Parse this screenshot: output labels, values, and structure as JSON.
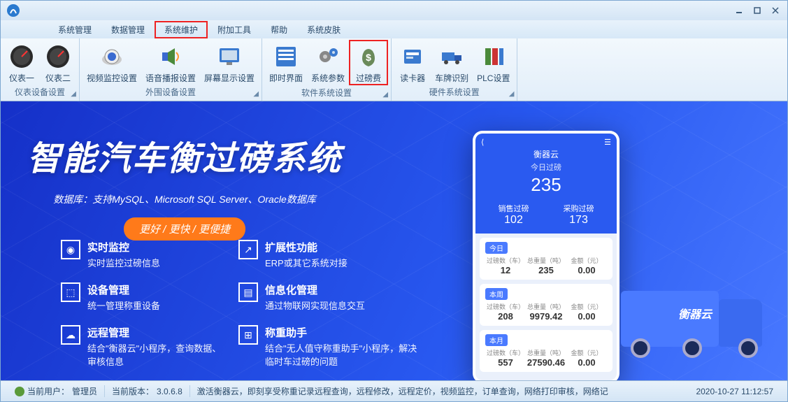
{
  "menu": {
    "items": [
      "系统管理",
      "数据管理",
      "系统维护",
      "附加工具",
      "帮助",
      "系统皮肤"
    ],
    "highlightIndex": 2
  },
  "ribbon": {
    "groups": [
      {
        "label": "仪表设备设置",
        "items": [
          {
            "label": "仪表一",
            "icon": "gauge"
          },
          {
            "label": "仪表二",
            "icon": "gauge"
          }
        ]
      },
      {
        "label": "外围设备设置",
        "items": [
          {
            "label": "视频监控设置",
            "icon": "camera"
          },
          {
            "label": "语音播报设置",
            "icon": "speaker"
          },
          {
            "label": "屏幕显示设置",
            "icon": "monitor"
          }
        ]
      },
      {
        "label": "软件系统设置",
        "items": [
          {
            "label": "即时界面",
            "icon": "form"
          },
          {
            "label": "系统参数",
            "icon": "gears"
          },
          {
            "label": "过磅费",
            "icon": "moneybag",
            "highlight": true
          }
        ]
      },
      {
        "label": "硬件系统设置",
        "items": [
          {
            "label": "读卡器",
            "icon": "cardreader"
          },
          {
            "label": "车牌识别",
            "icon": "truck"
          },
          {
            "label": "PLC设置",
            "icon": "plc"
          }
        ]
      }
    ]
  },
  "hero": {
    "title": "智能汽车衡过磅系统",
    "subtitle": "数据库：支持MySQL、Microsoft SQL Server、Oracle数据库",
    "badge": "更好 / 更快 / 更便捷"
  },
  "features": [
    {
      "icon": "monitor",
      "title": "实时监控",
      "desc": "实时监控过磅信息"
    },
    {
      "icon": "expand",
      "title": "扩展性功能",
      "desc": "ERP或其它系统对接"
    },
    {
      "icon": "device",
      "title": "设备管理",
      "desc": "统一管理称重设备"
    },
    {
      "icon": "info",
      "title": "信息化管理",
      "desc": "通过物联网实现信息交互"
    },
    {
      "icon": "remote",
      "title": "远程管理",
      "desc": "结合\"衡器云\"小程序，查询数据、审核信息"
    },
    {
      "icon": "helper",
      "title": "称重助手",
      "desc": "结合\"无人值守称重助手\"小程序，解决临时车过磅的问题"
    }
  ],
  "phone": {
    "appTitle": "衡器云",
    "todayLabel": "今日过磅",
    "todayNum": "235",
    "stats": [
      {
        "label": "销售过磅",
        "num": "102"
      },
      {
        "label": "采购过磅",
        "num": "173"
      }
    ],
    "cards": [
      {
        "period": "今日",
        "cols": [
          {
            "h": "过磅数（车）",
            "v": "12"
          },
          {
            "h": "总重量（吨）",
            "v": "235"
          },
          {
            "h": "金额（元）",
            "v": "0.00"
          }
        ]
      },
      {
        "period": "本周",
        "cols": [
          {
            "h": "过磅数（车）",
            "v": "208"
          },
          {
            "h": "总重量（吨）",
            "v": "9979.42"
          },
          {
            "h": "金额（元）",
            "v": "0.00"
          }
        ]
      },
      {
        "period": "本月",
        "cols": [
          {
            "h": "过磅数（车）",
            "v": "557"
          },
          {
            "h": "总重量（吨）",
            "v": "27590.46"
          },
          {
            "h": "金额（元）",
            "v": "0.00"
          }
        ]
      }
    ]
  },
  "truck": {
    "logo": "衡器云"
  },
  "status": {
    "userLabel": "当前用户：",
    "userValue": "管理员",
    "versionLabel": "当前版本：",
    "versionValue": "3.0.6.8",
    "marquee": "激活衡器云，即刻享受称重记录远程查询，远程修改，远程定价，视频监控，订单查询，网络打印审核，网络记",
    "datetime": "2020-10-27 11:12:57"
  },
  "icons": {
    "gauge": "◉",
    "camera": "📷",
    "speaker": "🔊",
    "monitor": "🖥",
    "form": "▤",
    "gears": "⚙",
    "moneybag": "💰",
    "cardreader": "▭",
    "truck": "🚚",
    "plc": "▦"
  }
}
